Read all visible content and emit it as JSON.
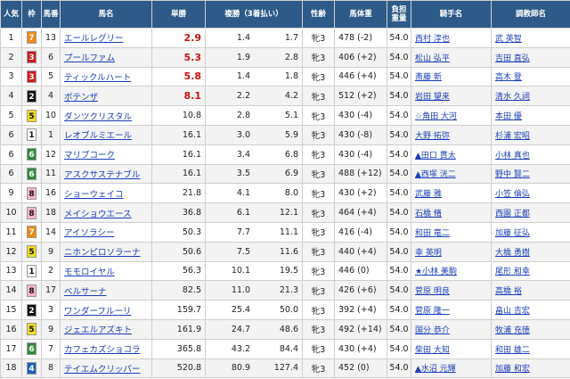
{
  "headers": {
    "rank": "人気",
    "waku": "枠",
    "horse_no": "馬番",
    "horse_name": "馬名",
    "win": "単勝",
    "place": "複勝（3着払い）",
    "sex_age": "性齢",
    "weight": "馬体重",
    "burden_line1": "負担",
    "burden_line2": "重量",
    "jockey": "騎手名",
    "trainer": "調教師名"
  },
  "colors": {
    "header_bg": "#2d5a88",
    "link": "#1a3fb8",
    "odds_highlight": "#d01010",
    "waku_1": "#ffffff",
    "waku_2": "#111111",
    "waku_3": "#d11a1a",
    "waku_4": "#1f5fbf",
    "waku_5": "#f2dd1c",
    "waku_6": "#2e8b3c",
    "waku_7": "#f08a12",
    "waku_8": "#f6b5c6"
  },
  "rows": [
    {
      "rank": "1",
      "waku": "7",
      "no": "13",
      "name": "エールレグリー",
      "win": "2.9",
      "pl_lo": "1.4",
      "pl_hi": "1.7",
      "sex": "牝3",
      "weight": "478 (-2)",
      "burden": "54.0",
      "jockey": "西村 淳也",
      "trainer": "武 英智"
    },
    {
      "rank": "2",
      "waku": "3",
      "no": "6",
      "name": "プールファム",
      "win": "5.3",
      "pl_lo": "1.9",
      "pl_hi": "2.8",
      "sex": "牝3",
      "weight": "406 (+2)",
      "burden": "54.0",
      "jockey": "松山 弘平",
      "trainer": "吉田 直弘"
    },
    {
      "rank": "3",
      "waku": "3",
      "no": "5",
      "name": "ティックルハート",
      "win": "5.8",
      "pl_lo": "1.4",
      "pl_hi": "1.8",
      "sex": "牝3",
      "weight": "446 (+4)",
      "burden": "54.0",
      "jockey": "斎藤 新",
      "trainer": "高木 登"
    },
    {
      "rank": "4",
      "waku": "2",
      "no": "4",
      "name": "ボテンザ",
      "win": "8.1",
      "pl_lo": "2.2",
      "pl_hi": "4.2",
      "sex": "牝3",
      "weight": "512 (+2)",
      "burden": "54.0",
      "jockey": "岩田 望来",
      "trainer": "清水 久詞"
    },
    {
      "rank": "5",
      "waku": "5",
      "no": "10",
      "name": "ダンツクリスタル",
      "win": "10.8",
      "pl_lo": "2.8",
      "pl_hi": "5.1",
      "sex": "牝3",
      "weight": "430 (-4)",
      "burden": "54.0",
      "jockey": "☆角田 大河",
      "trainer": "本田 優"
    },
    {
      "rank": "6",
      "waku": "1",
      "no": "1",
      "name": "レオブルミエール",
      "win": "16.1",
      "pl_lo": "3.0",
      "pl_hi": "5.9",
      "sex": "牝3",
      "weight": "430 (-8)",
      "burden": "54.0",
      "jockey": "大野 拓弥",
      "trainer": "杉浦 宏昭"
    },
    {
      "rank": "6",
      "waku": "6",
      "no": "12",
      "name": "マリブコーク",
      "win": "16.1",
      "pl_lo": "3.4",
      "pl_hi": "6.8",
      "sex": "牝3",
      "weight": "430 (-4)",
      "burden": "54.0",
      "jockey": "▲田口 貫太",
      "trainer": "小林 真也"
    },
    {
      "rank": "6",
      "waku": "6",
      "no": "11",
      "name": "アスクサステナブル",
      "win": "16.1",
      "pl_lo": "3.5",
      "pl_hi": "6.9",
      "sex": "牝3",
      "weight": "488 (+12)",
      "burden": "54.0",
      "jockey": "▲西塚 洸二",
      "trainer": "野中 賢二"
    },
    {
      "rank": "9",
      "waku": "8",
      "no": "16",
      "name": "ショーウェイコ",
      "win": "21.8",
      "pl_lo": "4.1",
      "pl_hi": "8.0",
      "sex": "牝3",
      "weight": "430 (+2)",
      "burden": "54.0",
      "jockey": "武藤 雅",
      "trainer": "小笠 倫弘"
    },
    {
      "rank": "10",
      "waku": "8",
      "no": "18",
      "name": "メイショウエース",
      "win": "36.8",
      "pl_lo": "6.1",
      "pl_hi": "12.1",
      "sex": "牝3",
      "weight": "464 (+4)",
      "burden": "54.0",
      "jockey": "石橋 脩",
      "trainer": "西園 正都"
    },
    {
      "rank": "11",
      "waku": "7",
      "no": "14",
      "name": "アイソラシー",
      "win": "50.3",
      "pl_lo": "7.7",
      "pl_hi": "11.1",
      "sex": "牝3",
      "weight": "416 (-4)",
      "burden": "54.0",
      "jockey": "和田 竜二",
      "trainer": "加藤 征弘"
    },
    {
      "rank": "12",
      "waku": "5",
      "no": "9",
      "name": "ニホンピロソラーナ",
      "win": "50.6",
      "pl_lo": "7.5",
      "pl_hi": "11.6",
      "sex": "牝3",
      "weight": "440 (+4)",
      "burden": "54.0",
      "jockey": "幸 英明",
      "trainer": "大橋 勇樹"
    },
    {
      "rank": "13",
      "waku": "1",
      "no": "2",
      "name": "モモロイヤル",
      "win": "56.3",
      "pl_lo": "10.1",
      "pl_hi": "19.5",
      "sex": "牝3",
      "weight": "446 (0)",
      "burden": "54.0",
      "jockey": "★小林 美駒",
      "trainer": "尾形 和幸"
    },
    {
      "rank": "14",
      "waku": "8",
      "no": "17",
      "name": "ベルサーナ",
      "win": "82.5",
      "pl_lo": "11.0",
      "pl_hi": "21.3",
      "sex": "牝3",
      "weight": "426 (+6)",
      "burden": "54.0",
      "jockey": "菅原 明良",
      "trainer": "高橋 裕"
    },
    {
      "rank": "15",
      "waku": "2",
      "no": "3",
      "name": "ワンダーフルーリ",
      "win": "159.7",
      "pl_lo": "25.4",
      "pl_hi": "50.0",
      "sex": "牝3",
      "weight": "392 (+4)",
      "burden": "54.0",
      "jockey": "菅原 隆一",
      "trainer": "畠山 吉宏"
    },
    {
      "rank": "16",
      "waku": "5",
      "no": "9",
      "name": "ジェエルアズキト",
      "win": "161.9",
      "pl_lo": "24.7",
      "pl_hi": "48.6",
      "sex": "牝3",
      "weight": "492 (+14)",
      "burden": "54.0",
      "jockey": "国分 恭介",
      "trainer": "牧浦 充徳"
    },
    {
      "rank": "17",
      "waku": "6",
      "no": "7",
      "name": "カフェカズショコラ",
      "win": "365.8",
      "pl_lo": "43.2",
      "pl_hi": "84.4",
      "sex": "牝3",
      "weight": "430 (+4)",
      "burden": "54.0",
      "jockey": "柴田 大知",
      "trainer": "和田 雄二"
    },
    {
      "rank": "18",
      "waku": "4",
      "no": "8",
      "name": "テイエムクリッパー",
      "win": "520.8",
      "pl_lo": "80.9",
      "pl_hi": "127.4",
      "sex": "牝3",
      "weight": "452 (0)",
      "burden": "54.0",
      "jockey": "▲水沼 元輝",
      "trainer": "加藤 和宏"
    }
  ]
}
